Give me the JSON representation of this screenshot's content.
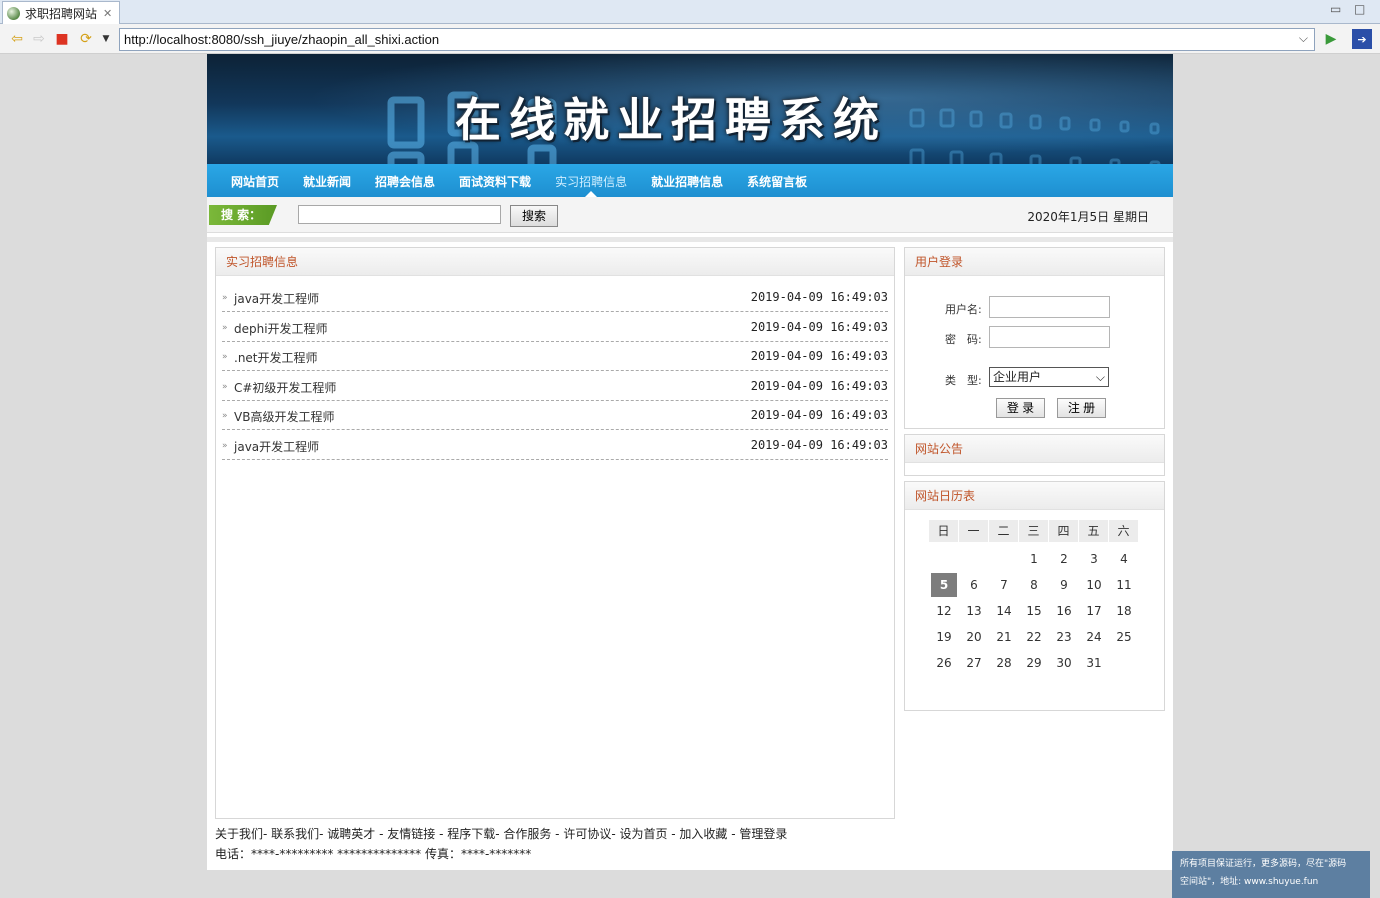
{
  "browser": {
    "tab_title": "求职招聘网站",
    "url": "http://localhost:8080/ssh_jiuye/zhaopin_all_shixi.action"
  },
  "banner": {
    "title": "在线就业招聘系统"
  },
  "nav": {
    "items": [
      "网站首页",
      "就业新闻",
      "招聘会信息",
      "面试资料下载",
      "实习招聘信息",
      "就业招聘信息",
      "系统留言板"
    ],
    "active": "实习招聘信息"
  },
  "search": {
    "label": "搜 索：",
    "button": "搜索",
    "date": "2020年1月5日  星期日"
  },
  "jobs": {
    "title": "实习招聘信息",
    "items": [
      {
        "title": "java开发工程师",
        "date": "2019-04-09 16:49:03"
      },
      {
        "title": "dephi开发工程师",
        "date": "2019-04-09 16:49:03"
      },
      {
        "title": ".net开发工程师",
        "date": "2019-04-09 16:49:03"
      },
      {
        "title": "C#初级开发工程师",
        "date": "2019-04-09 16:49:03"
      },
      {
        "title": "VB高级开发工程师",
        "date": "2019-04-09 16:49:03"
      },
      {
        "title": "java开发工程师",
        "date": "2019-04-09 16:49:03"
      }
    ]
  },
  "login": {
    "title": "用户登录",
    "username_label": "用户名:",
    "password_label": "密　码:",
    "type_label": "类　型:",
    "type_value": "企业用户",
    "login_button": "登 录",
    "register_button": "注 册"
  },
  "notice": {
    "title": "网站公告"
  },
  "calendar": {
    "title": "网站日历表",
    "weekdays": [
      "日",
      "一",
      "二",
      "三",
      "四",
      "五",
      "六"
    ],
    "weeks": [
      [
        "",
        "",
        "",
        "1",
        "2",
        "3",
        "4"
      ],
      [
        "5",
        "6",
        "7",
        "8",
        "9",
        "10",
        "11"
      ],
      [
        "12",
        "13",
        "14",
        "15",
        "16",
        "17",
        "18"
      ],
      [
        "19",
        "20",
        "21",
        "22",
        "23",
        "24",
        "25"
      ],
      [
        "26",
        "27",
        "28",
        "29",
        "30",
        "31",
        ""
      ]
    ],
    "today": "5"
  },
  "footer": {
    "links": "关于我们- 联系我们- 诚聘英才 - 友情链接 - 程序下载- 合作服务 - 许可协议- 设为首页 - 加入收藏 - 管理登录",
    "phone": "电话：****-********* ************** 传真：****-*******"
  },
  "watermark": {
    "line1": "所有项目保证运行，更多源码，尽在\"源码",
    "line2": "空间站\"，地址: www.shuyue.fun"
  }
}
